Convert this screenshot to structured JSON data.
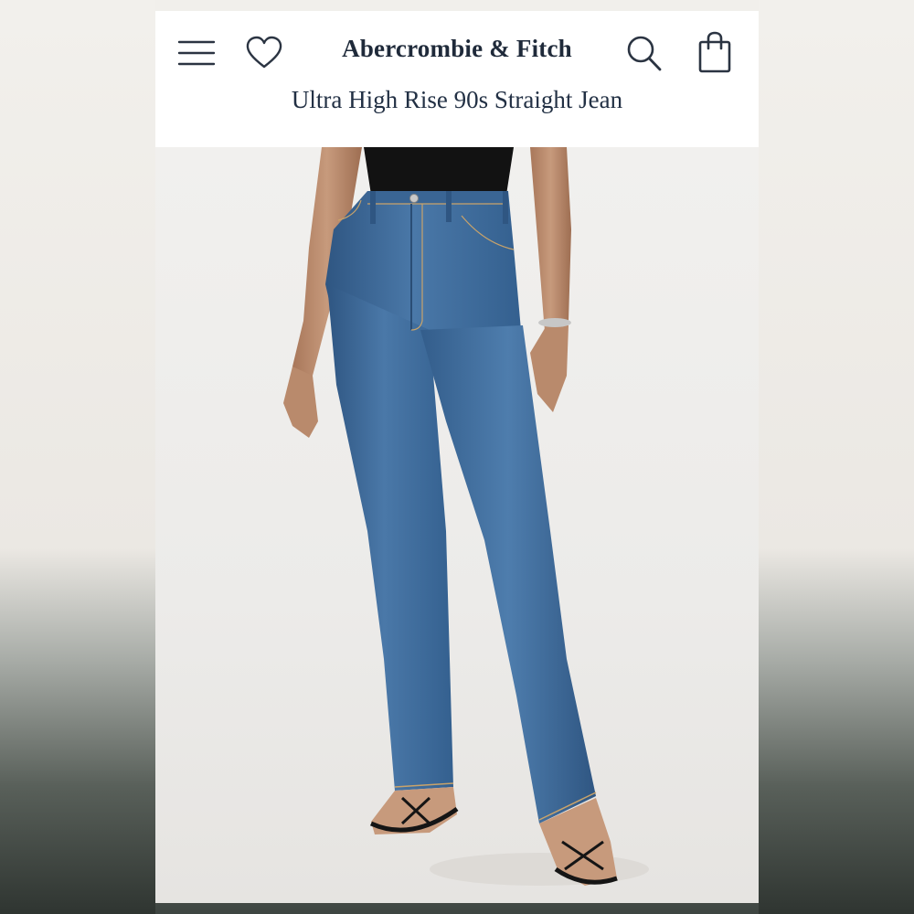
{
  "header": {
    "brand": "Abercrombie & Fitch",
    "product_title": "Ultra High Rise 90s Straight Jean",
    "icons": [
      "hamburger-menu-icon",
      "heart-icon",
      "search-icon",
      "shopping-bag-icon"
    ]
  },
  "colors": {
    "brand_text": "#1f2a3a",
    "header_bg": "#ffffff",
    "denim": "#3f6a99"
  }
}
